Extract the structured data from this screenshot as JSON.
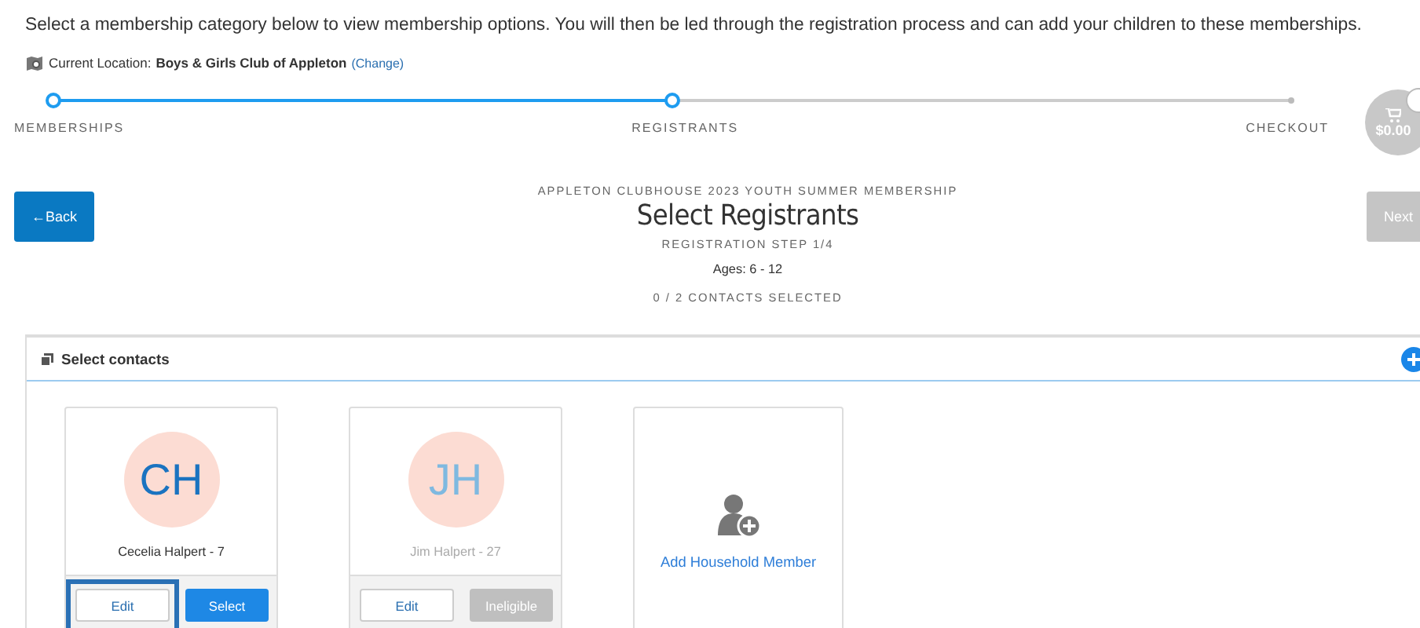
{
  "intro": "Select a membership category below to view membership options. You will then be led through the registration process and can add your children to these memberships.",
  "location": {
    "label": "Current Location:",
    "name": "Boys & Girls Club of Appleton",
    "change": "(Change)"
  },
  "steps": [
    {
      "label": "MEMBERSHIPS",
      "reached": true
    },
    {
      "label": "REGISTRANTS",
      "reached": true
    },
    {
      "label": "CHECKOUT",
      "reached": false
    }
  ],
  "cart": {
    "total": "$0.00"
  },
  "header": {
    "program": "APPLETON CLUBHOUSE 2023 YOUTH SUMMER MEMBERSHIP",
    "title": "Select Registrants",
    "step": "REGISTRATION STEP 1/4",
    "ages": "Ages: 6 - 12",
    "selected_count": "0 / 2 CONTACTS SELECTED"
  },
  "back": "←Back",
  "next": {
    "label": "Next",
    "disabled": true
  },
  "panel": {
    "title": "Select contacts"
  },
  "contacts": [
    {
      "initials": "CH",
      "name": "Cecelia Halpert - 7",
      "eligible": true,
      "focused": true,
      "edit": "Edit",
      "action": "Select"
    },
    {
      "initials": "JH",
      "name": "Jim Halpert - 27",
      "eligible": false,
      "focused": false,
      "edit": "Edit",
      "action": "Ineligible"
    }
  ],
  "add_member": "Add Household Member"
}
